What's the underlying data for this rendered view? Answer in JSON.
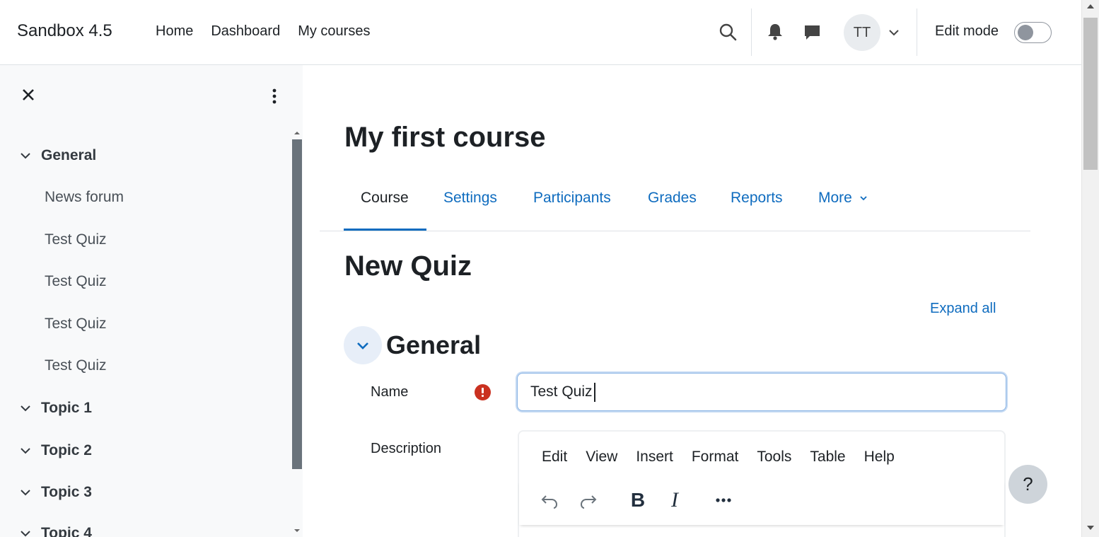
{
  "navbar": {
    "site_name": "Sandbox 4.5",
    "links": [
      "Home",
      "Dashboard",
      "My courses"
    ],
    "user_initials": "TT",
    "edit_mode_label": "Edit mode",
    "edit_mode_on": false
  },
  "course_index": {
    "sections": [
      {
        "title": "General",
        "items": [
          "News forum",
          "Test Quiz",
          "Test Quiz",
          "Test Quiz",
          "Test Quiz"
        ]
      },
      {
        "title": "Topic 1",
        "items": []
      },
      {
        "title": "Topic 2",
        "items": []
      },
      {
        "title": "Topic 3",
        "items": []
      },
      {
        "title": "Topic 4",
        "items": []
      }
    ]
  },
  "course": {
    "title": "My first course",
    "tabs": [
      {
        "label": "Course",
        "active": true
      },
      {
        "label": "Settings",
        "active": false
      },
      {
        "label": "Participants",
        "active": false
      },
      {
        "label": "Grades",
        "active": false
      },
      {
        "label": "Reports",
        "active": false
      },
      {
        "label": "More",
        "active": false
      }
    ]
  },
  "form": {
    "heading": "New Quiz",
    "expand_all": "Expand all",
    "section_title": "General",
    "name_label": "Name",
    "name_value": "Test Quiz",
    "description_label": "Description",
    "editor_menu": [
      "Edit",
      "View",
      "Insert",
      "Format",
      "Tools",
      "Table",
      "Help"
    ],
    "editor_bold": "B",
    "editor_italic": "I"
  },
  "help_button": "?",
  "colors": {
    "link": "#0f6cbf",
    "required": "#ca3120",
    "drawer_bg": "#f8f9fa"
  }
}
